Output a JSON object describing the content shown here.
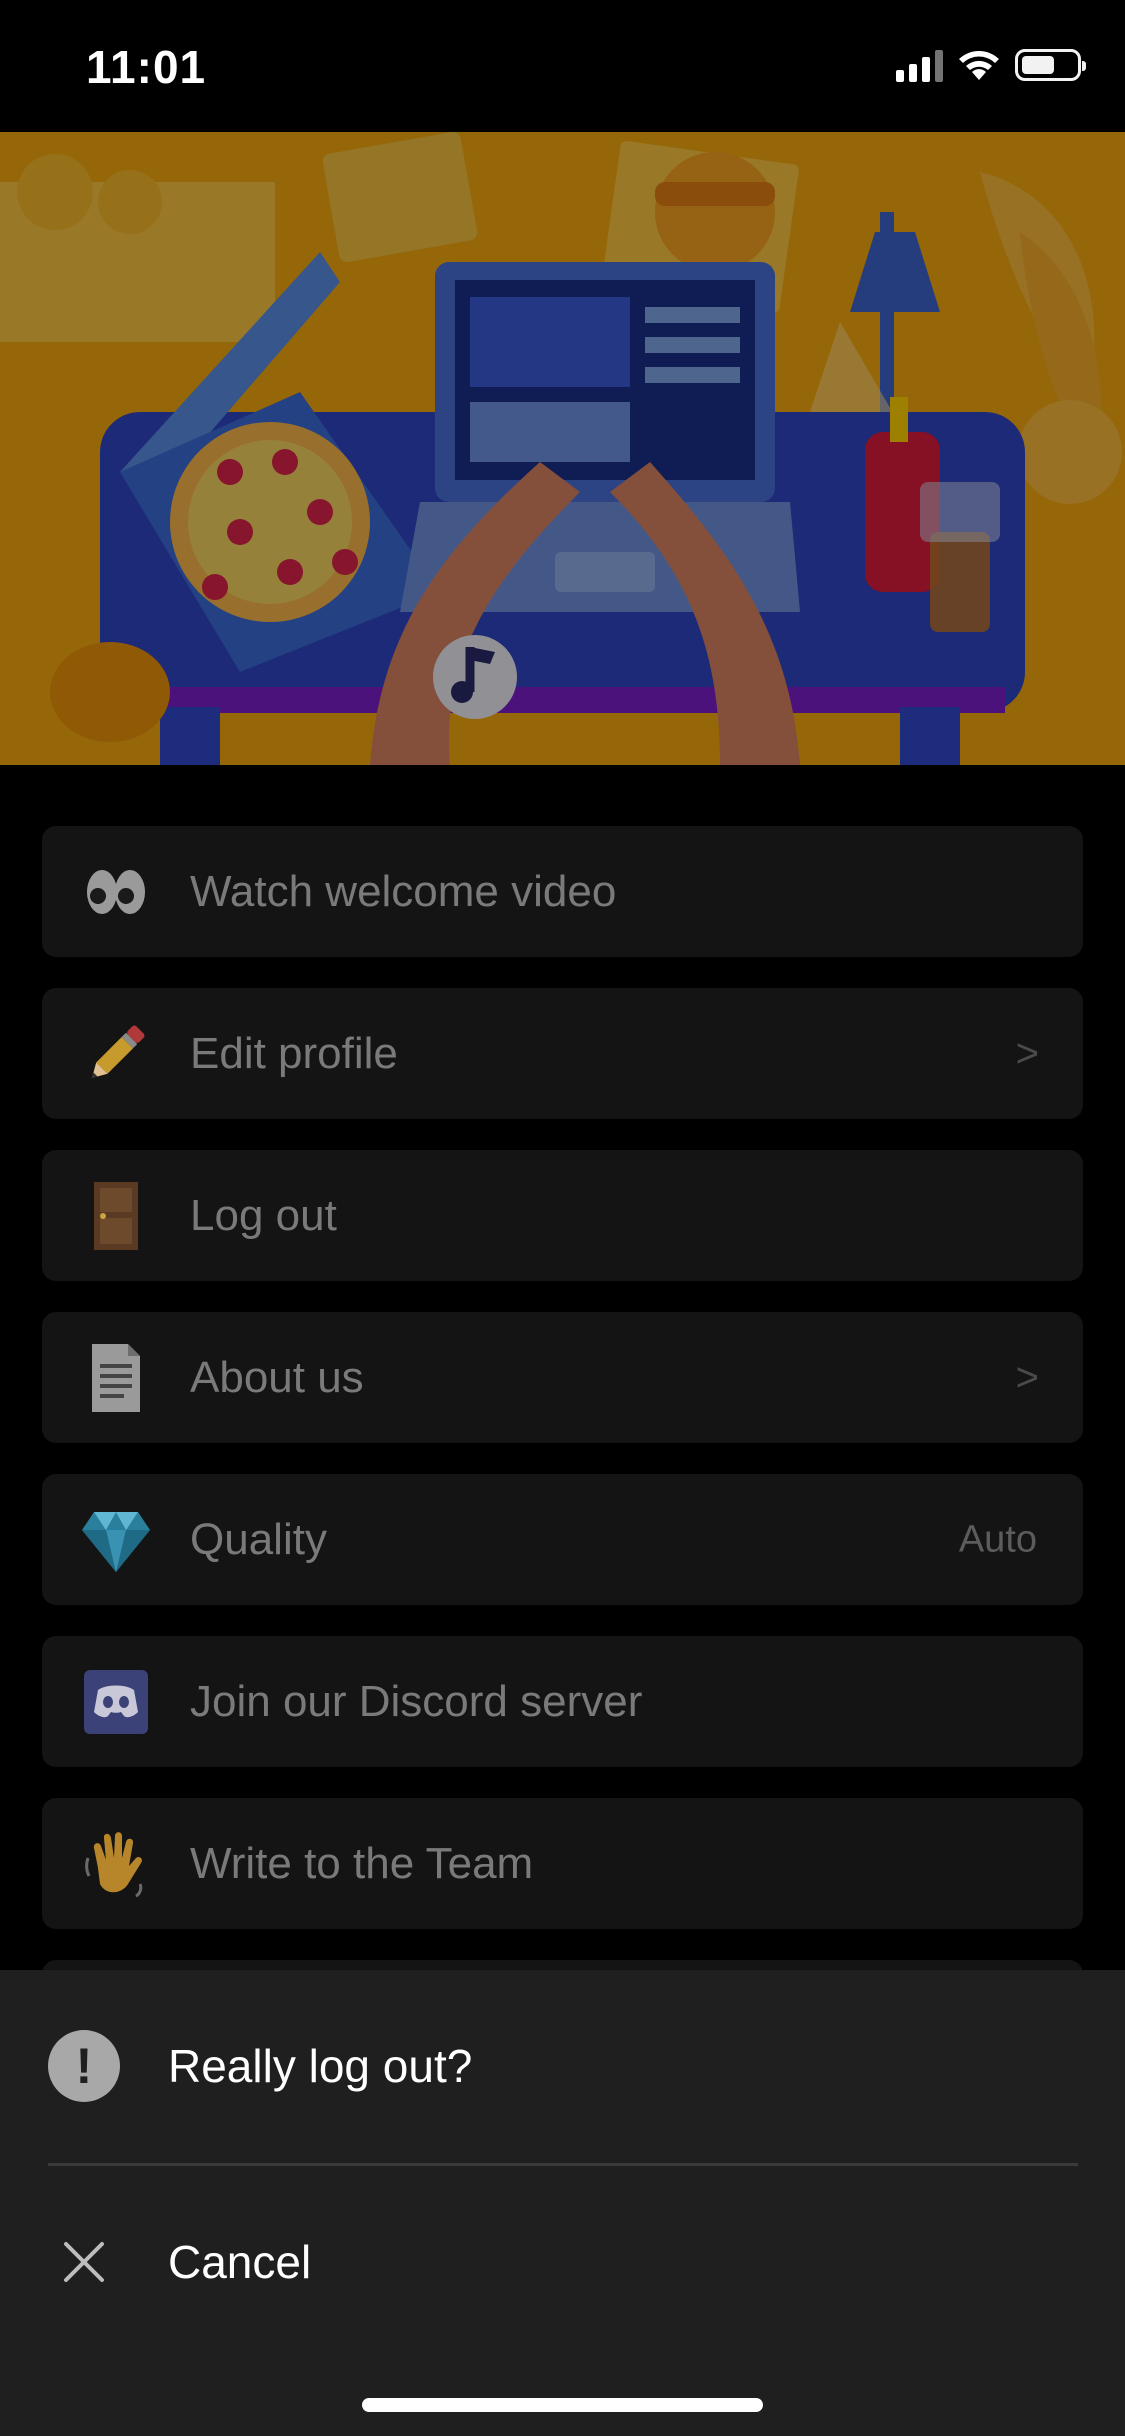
{
  "status_bar": {
    "time": "11:01"
  },
  "colors": {
    "background": "#000000",
    "card": "#141414",
    "sheet": "#1f1f1f",
    "hero_orange": "#f2a60f",
    "hero_blue": "#3b55c9"
  },
  "hero": {
    "illustration": "desk-laptop-pizza-illustration"
  },
  "menu": {
    "items": [
      {
        "icon": "eyes-icon",
        "label": "Watch welcome video"
      },
      {
        "icon": "pencil-icon",
        "label": "Edit profile",
        "chevron": ">"
      },
      {
        "icon": "door-icon",
        "label": "Log out"
      },
      {
        "icon": "document-icon",
        "label": "About us",
        "chevron": ">"
      },
      {
        "icon": "gem-icon",
        "label": "Quality",
        "value": "Auto"
      },
      {
        "icon": "discord-icon",
        "label": "Join our Discord server"
      },
      {
        "icon": "waving-hand-icon",
        "label": "Write to the Team"
      }
    ]
  },
  "sheet": {
    "title_icon": "!",
    "title": "Really log out?",
    "cancel_icon": "close-icon",
    "cancel_label": "Cancel"
  }
}
